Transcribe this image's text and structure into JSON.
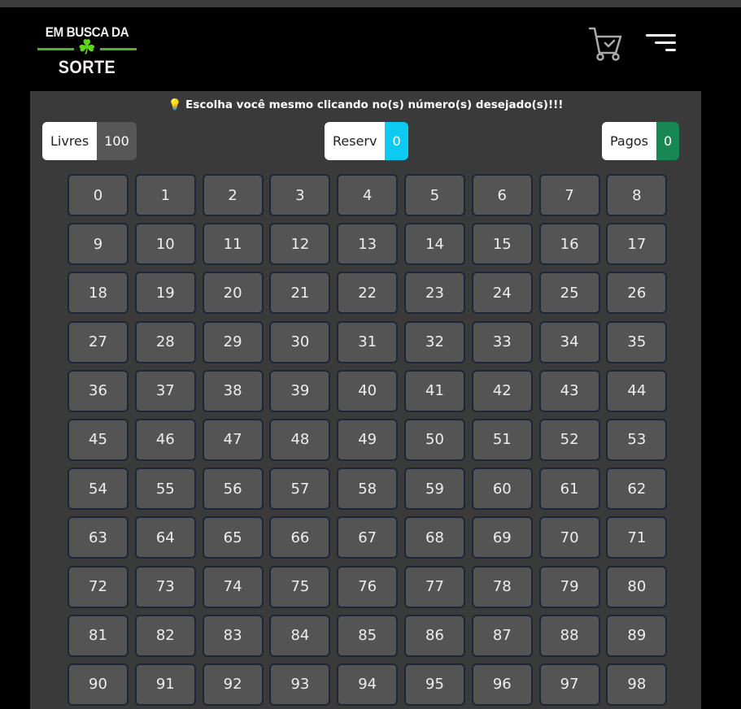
{
  "logo": {
    "line1": "EM BUSCA DA",
    "line2": "SORTE"
  },
  "header": {
    "cart_icon": "cart-check-icon",
    "menu_icon": "hamburger-menu-icon"
  },
  "panel": {
    "instruction": "💡 Escolha você mesmo clicando no(s) número(s) desejado(s)!!!",
    "stats": [
      {
        "label": "Livres",
        "value": "100",
        "color": "#575757"
      },
      {
        "label": "Reserv",
        "value": "0",
        "color": "#0dcaf0"
      },
      {
        "label": "Pagos",
        "value": "0",
        "color": "#198754"
      }
    ],
    "numbers_start": 0,
    "numbers_end": 98
  }
}
